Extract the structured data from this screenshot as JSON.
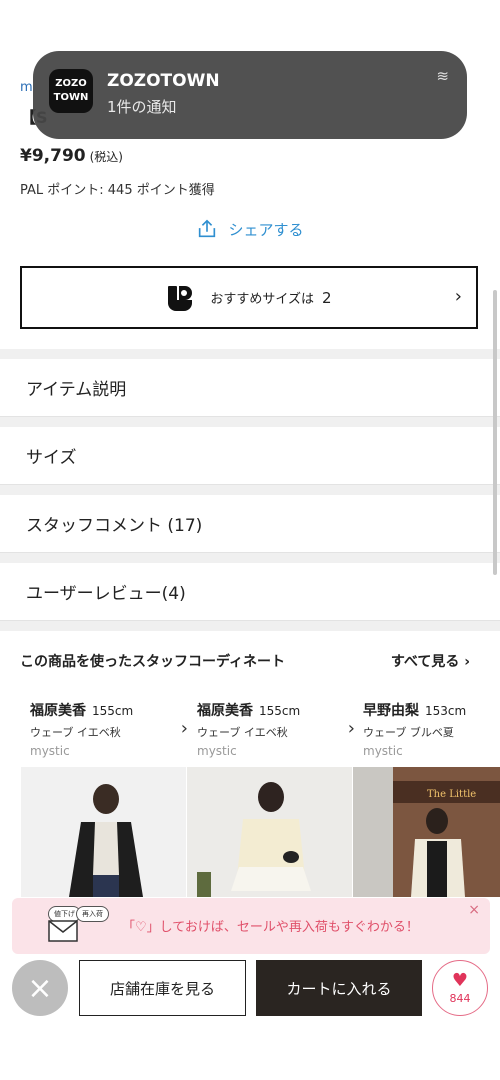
{
  "product": {
    "brand_peek": "m",
    "title_peek": "【S",
    "price": "¥9,790",
    "tax_label": "(税込)",
    "points": "PAL ポイント: 445 ポイント獲得"
  },
  "share": {
    "label": "シェアする",
    "icon": "share-icon",
    "color": "#2f8fd0"
  },
  "size_recommend": {
    "label": "おすすめサイズは",
    "value": "2",
    "icon": "size-logo-icon"
  },
  "sections": [
    {
      "label": "アイテム説明"
    },
    {
      "label": "サイズ"
    },
    {
      "label": "スタッフコメント (17)"
    },
    {
      "label": "ユーザーレビュー(4)"
    }
  ],
  "coordinates": {
    "heading": "この商品を使ったスタッフコーディネート",
    "see_all": "すべて見る ›",
    "staff": [
      {
        "name": "福原美香",
        "height": "155cm",
        "meta": "ウェーブ  イエベ秋",
        "brand": "mystic"
      },
      {
        "name": "福原美香",
        "height": "155cm",
        "meta": "ウェーブ  イエベ秋",
        "brand": "mystic"
      },
      {
        "name": "早野由梨",
        "height": "153cm",
        "meta": "ウェーブ  ブルベ夏",
        "brand": "mystic"
      }
    ]
  },
  "notification": {
    "app_icon_line1": "ZOZO",
    "app_icon_line2": "TOWN",
    "app_name": "ZOZOTOWN",
    "message": "1件の通知"
  },
  "promo": {
    "text": "「♡」しておけば、セールや再入荷もすぐわかる！",
    "bubble1": "値下げ",
    "bubble2": "再入荷",
    "close": "×"
  },
  "actions": {
    "close": "×",
    "store_stock": "店舗在庫を見る",
    "add_to_cart": "カートに入れる",
    "favorite_count": "844",
    "favorite_icon": "♥"
  },
  "colors": {
    "link": "#2f8fd0",
    "cart_bg": "#2a2521",
    "favorite": "#e0345a",
    "promo_bg": "#fbe3e8"
  }
}
